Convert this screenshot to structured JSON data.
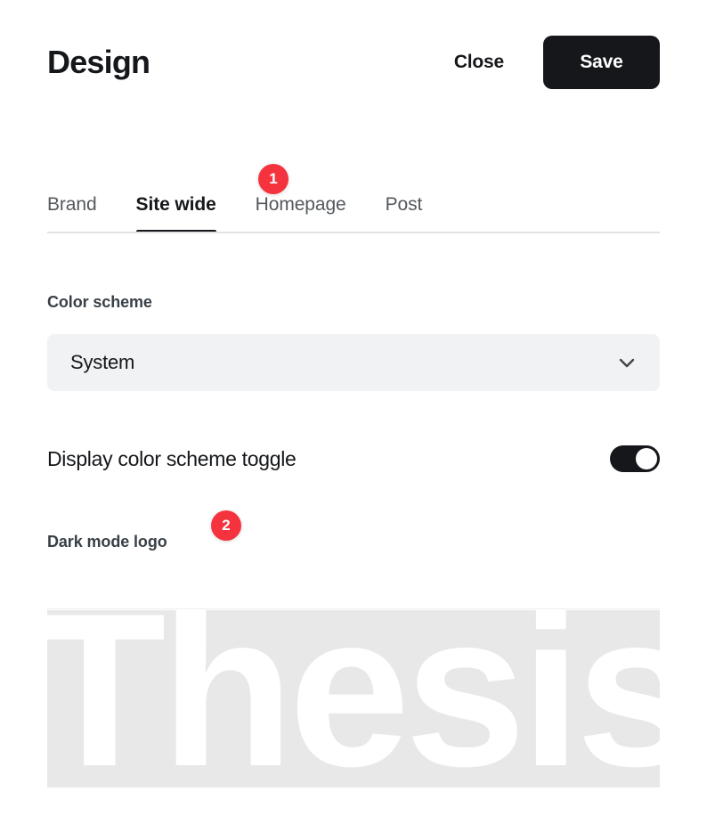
{
  "header": {
    "title": "Design",
    "close_label": "Close",
    "save_label": "Save"
  },
  "tabs": [
    {
      "label": "Brand",
      "active": false
    },
    {
      "label": "Site wide",
      "active": true
    },
    {
      "label": "Homepage",
      "active": false
    },
    {
      "label": "Post",
      "active": false
    }
  ],
  "step_badges": [
    {
      "number": "1"
    },
    {
      "number": "2"
    }
  ],
  "color_scheme": {
    "label": "Color scheme",
    "value": "System",
    "chevron_icon": "chevron-down-icon"
  },
  "color_scheme_toggle": {
    "label": "Display color scheme toggle",
    "state": "on"
  },
  "dark_mode_logo": {
    "label": "Dark mode logo",
    "preview_text": "Thesis"
  },
  "colors": {
    "accent_badge": "#F5333F",
    "button_dark": "#15171B",
    "field_background": "#F1F2F4",
    "text_primary": "#15171A",
    "text_secondary": "#54595D",
    "divider": "#E1E2E6",
    "preview_background": "#E8E8E8"
  }
}
